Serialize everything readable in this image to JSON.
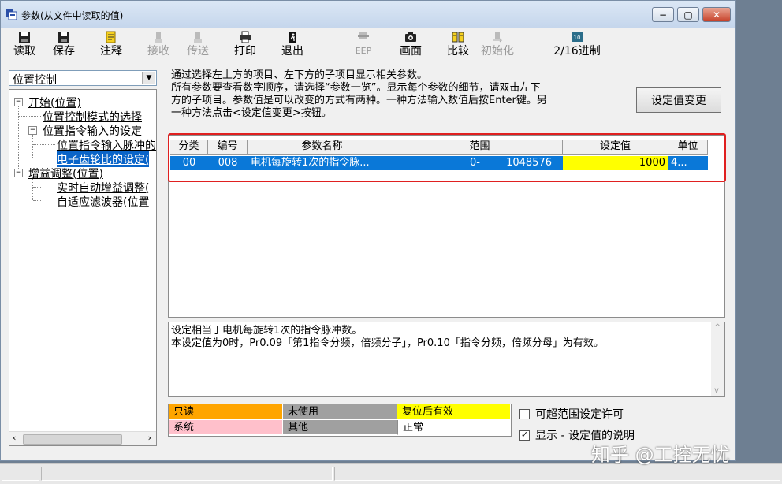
{
  "window": {
    "title": "参数(从文件中读取的值)",
    "controls": {
      "minimize": "−",
      "maximize": "▢",
      "close": "✕"
    }
  },
  "toolbar": [
    {
      "label": "读取",
      "icon": "floppy-disk-icon",
      "enabled": true
    },
    {
      "label": "保存",
      "icon": "floppy-disk-icon",
      "enabled": true
    },
    {
      "label": "注释",
      "icon": "note-icon",
      "enabled": true
    },
    {
      "label": "接收",
      "icon": "receive-icon",
      "enabled": false
    },
    {
      "label": "传送",
      "icon": "send-icon",
      "enabled": false
    },
    {
      "label": "打印",
      "icon": "printer-icon",
      "enabled": true
    },
    {
      "label": "退出",
      "icon": "exit-icon",
      "enabled": true
    },
    {
      "label": "EEP",
      "icon": "eeprom-icon",
      "enabled": false
    },
    {
      "label": "画面",
      "icon": "camera-icon",
      "enabled": true
    },
    {
      "label": "比较",
      "icon": "compare-icon",
      "enabled": true
    },
    {
      "label": "初始化",
      "icon": "initialize-icon",
      "enabled": false
    },
    {
      "label": "2/16进制",
      "icon": "hex-icon",
      "enabled": true
    }
  ],
  "mode_select": {
    "value": "位置控制"
  },
  "tree": [
    {
      "label": "开始(位置)",
      "level": 0,
      "expander": "−"
    },
    {
      "label": "位置控制模式的选择",
      "level": 1
    },
    {
      "label": "位置指令输入的设定",
      "level": 1,
      "expander": "−"
    },
    {
      "label": "位置指令输入脉冲的",
      "level": 2
    },
    {
      "label": "电子齿轮比的设定(",
      "level": 2,
      "selected": true
    },
    {
      "label": "增益调整(位置)",
      "level": 0,
      "expander": "−"
    },
    {
      "label": "实时自动增益调整(",
      "level": 1
    },
    {
      "label": "自适应滤波器(位置",
      "level": 1
    }
  ],
  "instructions": {
    "line1": "通过选择左上方的项目、左下方的子项目显示相关参数。",
    "line2": "所有参数要查看数字顺序，请选择“参数一览”。显示每个参数的细节，请双击左下",
    "line3": "方的子项目。参数值是可以改变的方式有两种。一种方法输入数值后按Enter键。另",
    "line4": "一种方法点击<设定值变更>按钮。"
  },
  "apply_button": {
    "label": "设定值变更"
  },
  "table": {
    "headers": [
      "分类",
      "编号",
      "参数名称",
      "范围",
      "设定值",
      "单位"
    ],
    "rows": [
      {
        "category": "00",
        "number": "008",
        "name": "电机每旋转1次的指令脉...",
        "range_min": "0-",
        "range_max": "1048576",
        "value": "1000",
        "unit": "4..."
      }
    ]
  },
  "description": {
    "line1": "设定相当于电机每旋转1次的指令脉冲数。",
    "line2": "本设定值为0时，Pr0.09「第1指令分频，倍频分子」，Pr0.10「指令分频，倍频分母」为有效。"
  },
  "legend": [
    {
      "label": "只读",
      "color": "#ffa500"
    },
    {
      "label": "未使用",
      "color": "#a0a0a0"
    },
    {
      "label": "复位后有效",
      "color": "#ffff00"
    },
    {
      "label": "系统",
      "color": "#ffc0cb"
    },
    {
      "label": "其他",
      "color": "#a0a0a0"
    },
    {
      "label": "正常",
      "color": "#ffffff"
    }
  ],
  "options": {
    "allow_out_of_range": {
      "label": "可超范围设定许可",
      "checked": false
    },
    "show_description": {
      "label": "显示 - 设定值的说明",
      "checked": true
    }
  },
  "watermark": "知乎 @工控无忧",
  "colors": {
    "selection": "#0a78d8",
    "value_highlight": "#ffff00",
    "annotation_box": "#e02020"
  }
}
